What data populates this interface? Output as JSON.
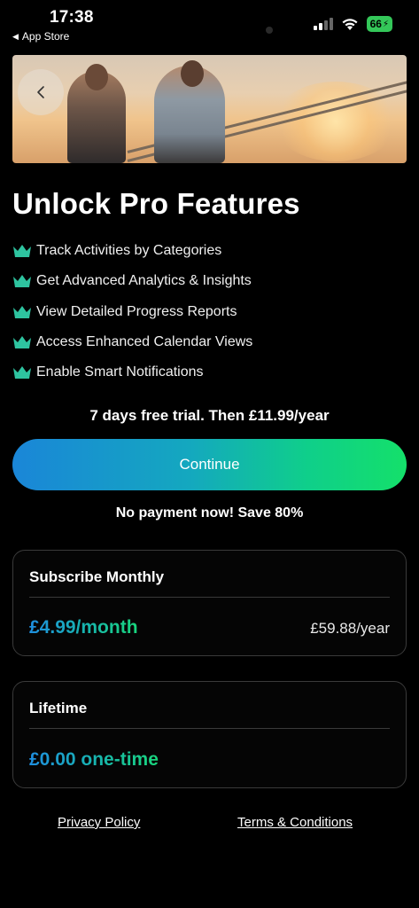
{
  "status_bar": {
    "time": "17:38",
    "back_label": "App Store",
    "battery": "66",
    "signal_icon": "cellular-signal-icon",
    "wifi_icon": "wifi-icon"
  },
  "hero": {
    "back_icon": "chevron-left-icon"
  },
  "title": "Unlock Pro Features",
  "features": [
    "Track Activities by Categories",
    "Get Advanced Analytics & Insights",
    "View Detailed Progress Reports",
    "Access Enhanced Calendar Views",
    "Enable Smart Notifications"
  ],
  "feature_icon": "crown-icon",
  "trial_text": "7 days free trial. Then £11.99/year",
  "continue_label": "Continue",
  "no_payment_text": "No payment now! Save 80%",
  "plans": {
    "monthly": {
      "name": "Subscribe Monthly",
      "price": "£4.99/month",
      "alt_price": "£59.88/year"
    },
    "lifetime": {
      "name": "Lifetime",
      "price": "£0.00 one-time"
    }
  },
  "footer": {
    "privacy": "Privacy Policy",
    "terms": "Terms & Conditions"
  },
  "colors": {
    "background": "#000000",
    "accent_green": "#1ed38a",
    "accent_blue": "#1a86d8",
    "battery": "#34c759"
  }
}
